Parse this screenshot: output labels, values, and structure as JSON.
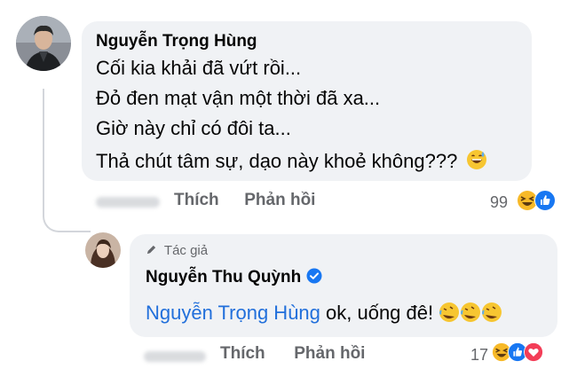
{
  "comment1": {
    "author": "Nguyễn Trọng Hùng",
    "lines": [
      "Cối kia khải đã vứt rồi...",
      "Đỏ đen mạt vận một thời đã xa...",
      "Giờ này chỉ có đôi ta...",
      "Thả chút tâm sự, dạo này khoẻ không???"
    ],
    "actions": {
      "like": "Thích",
      "reply": "Phản hồi"
    },
    "reaction_count": "99",
    "reaction_icons": [
      "haha-icon",
      "like-icon"
    ]
  },
  "comment2": {
    "badge_label": "Tác giả",
    "author": "Nguyễn Thu Quỳnh",
    "mention": "Nguyễn Trọng Hùng",
    "text": " ok, uống đê!",
    "actions": {
      "like": "Thích",
      "reply": "Phản hồi"
    },
    "reaction_count": "17",
    "reaction_icons": [
      "haha-icon",
      "like-icon",
      "love-icon"
    ]
  },
  "colors": {
    "bubble": "#f0f2f5",
    "mention": "#216fdb",
    "muted": "#65676b",
    "like_blue": "#1877f2",
    "haha_yellow": "#f7b928",
    "love_red": "#f33e58"
  }
}
